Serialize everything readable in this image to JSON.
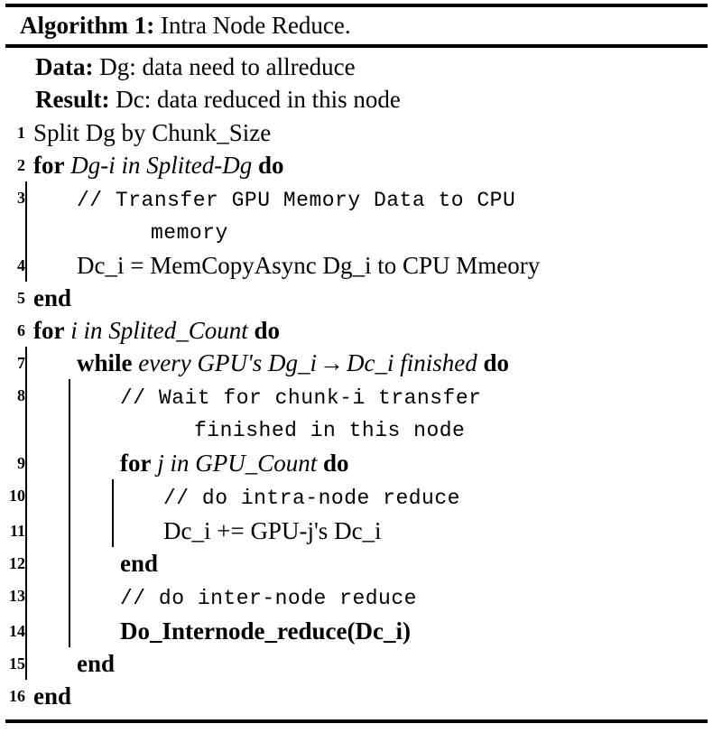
{
  "caption": {
    "label": "Algorithm 1:",
    "title": "Intra Node Reduce."
  },
  "io": [
    {
      "key": "Data:",
      "value": "Dg: data need to allreduce"
    },
    {
      "key": "Result:",
      "value": "Dc: data reduced in this node"
    }
  ],
  "lines": [
    {
      "no": "1",
      "indent": 0,
      "kind": "stmt",
      "text": "Split Dg by Chunk_Size"
    },
    {
      "no": "2",
      "indent": 0,
      "kind": "for",
      "kw1": "for",
      "var": "Dg-i in Splited-Dg",
      "kw2": "do"
    },
    {
      "no": "3",
      "indent": 1,
      "kind": "comment",
      "text": "// Transfer GPU Memory Data to CPU",
      "cont": "memory"
    },
    {
      "no": "4",
      "indent": 1,
      "kind": "stmt",
      "text": "Dc_i = MemCopyAsync Dg_i to CPU Mmeory"
    },
    {
      "no": "5",
      "indent": 0,
      "kind": "end",
      "text": "end"
    },
    {
      "no": "6",
      "indent": 0,
      "kind": "for",
      "kw1": "for",
      "var": "i in Splited_Count",
      "kw2": "do"
    },
    {
      "no": "7",
      "indent": 1,
      "kind": "while",
      "kw1": "while",
      "var_a": "every GPU's Dg_i",
      "arrow": "→",
      "var_b": "Dc_i finished",
      "kw2": "do"
    },
    {
      "no": "8",
      "indent": 2,
      "kind": "comment",
      "text": "// Wait for chunk-i transfer",
      "cont": "finished in this node"
    },
    {
      "no": "9",
      "indent": 2,
      "kind": "for",
      "kw1": "for",
      "var": "j in GPU_Count",
      "kw2": "do"
    },
    {
      "no": "10",
      "indent": 3,
      "kind": "comment",
      "text": "// do intra-node reduce"
    },
    {
      "no": "11",
      "indent": 3,
      "kind": "stmt",
      "text": "Dc_i += GPU-j's Dc_i"
    },
    {
      "no": "12",
      "indent": 2,
      "kind": "end",
      "text": "end"
    },
    {
      "no": "13",
      "indent": 2,
      "kind": "comment",
      "text": "// do inter-node reduce"
    },
    {
      "no": "14",
      "indent": 2,
      "kind": "call",
      "text": "Do_Internode_reduce(Dc_i)"
    },
    {
      "no": "15",
      "indent": 1,
      "kind": "end",
      "text": "end"
    },
    {
      "no": "16",
      "indent": 0,
      "kind": "end",
      "text": "end"
    }
  ],
  "colors": {
    "rule": "#000000",
    "text": "#000000",
    "comment": "#000000"
  }
}
